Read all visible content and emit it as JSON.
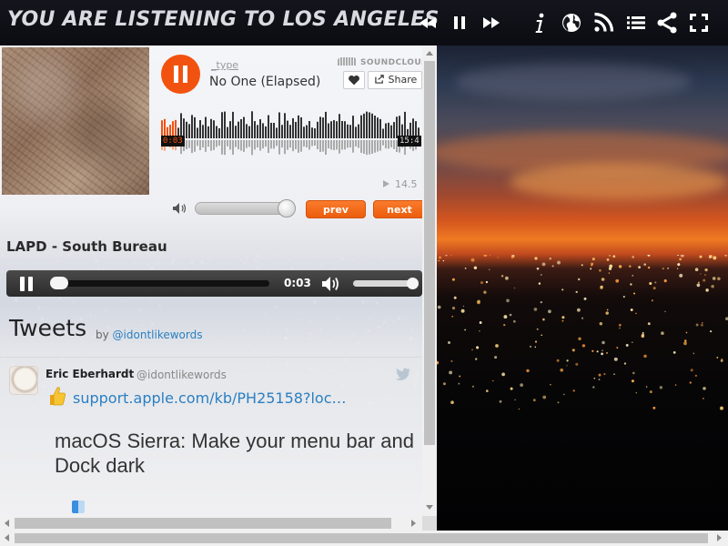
{
  "header": {
    "title": "YOU ARE LISTENING TO LOS ANGELES",
    "icons": [
      "prev-icon",
      "pause-icon",
      "next-icon",
      "info-icon",
      "globe-icon",
      "rss-icon",
      "list-icon",
      "share-icon",
      "fullscreen-icon"
    ]
  },
  "soundcloud": {
    "user": "_type",
    "track": "No One (Elapsed)",
    "brand": "SOUNDCLOUD",
    "share_label": "Share",
    "elapsed": "0:03",
    "duration": "15:4",
    "plays": "14.5",
    "prev_label": "prev",
    "next_label": "next",
    "accent": "#f2520f"
  },
  "stream": {
    "title": "LAPD - South Bureau",
    "time": "0:03"
  },
  "tweets": {
    "heading": "Tweets",
    "by": "by",
    "by_handle": "@idontlikewords",
    "tweet": {
      "name": "Eric Eberhardt",
      "handle": "@idontlikewords",
      "link": "support.apple.com/kb/PH25158?loc…",
      "text": "macOS Sierra: Make your menu bar and Dock dark"
    },
    "link_color": "#2a7fc2"
  }
}
